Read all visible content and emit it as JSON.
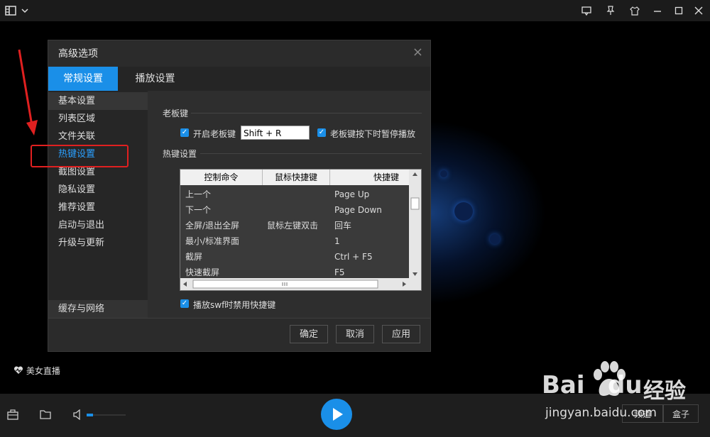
{
  "dialog": {
    "title": "高级选项",
    "close_glyph": "×",
    "tabs": [
      {
        "label": "常规设置",
        "active": true
      },
      {
        "label": "播放设置",
        "active": false
      }
    ],
    "sidebar": [
      {
        "label": "基本设置"
      },
      {
        "label": "列表区域"
      },
      {
        "label": "文件关联"
      },
      {
        "label": "热键设置"
      },
      {
        "label": "截图设置"
      },
      {
        "label": "隐私设置"
      },
      {
        "label": "推荐设置"
      },
      {
        "label": "启动与退出"
      },
      {
        "label": "升级与更新"
      }
    ],
    "sidebar_bottom": "缓存与网络",
    "boss_key": {
      "section_title": "老板键",
      "enable_label": "开启老板键",
      "enable_checked": true,
      "key_value": "Shift + R",
      "pause_label": "老板键按下时暂停播放",
      "pause_checked": true
    },
    "hotkeys": {
      "section_title": "热键设置",
      "columns": [
        "控制命令",
        "鼠标快捷键",
        "快捷键"
      ],
      "rows": [
        {
          "cmd": "上一个",
          "mouse": "",
          "key": "Page Up"
        },
        {
          "cmd": "下一个",
          "mouse": "",
          "key": "Page Down"
        },
        {
          "cmd": "全屏/退出全屏",
          "mouse": "鼠标左键双击",
          "key": "回车"
        },
        {
          "cmd": "最小/标准界面",
          "mouse": "",
          "key": "1"
        },
        {
          "cmd": "截屏",
          "mouse": "",
          "key": "Ctrl + F5"
        },
        {
          "cmd": "快速截屏",
          "mouse": "",
          "key": "F5"
        }
      ],
      "swf_label": "播放swf时禁用快捷键",
      "swf_checked": true
    },
    "buttons": {
      "ok": "确定",
      "cancel": "取消",
      "apply": "应用"
    }
  },
  "live_label": "美女直播",
  "bottom_buttons": [
    "频道",
    "盒子"
  ],
  "watermark": {
    "brand": "Bai",
    "brand2": "du",
    "brand_cn": "经验",
    "url": "jingyan.baidu.com"
  },
  "colors": {
    "accent": "#1a8fe8",
    "annotation": "#e02020"
  }
}
